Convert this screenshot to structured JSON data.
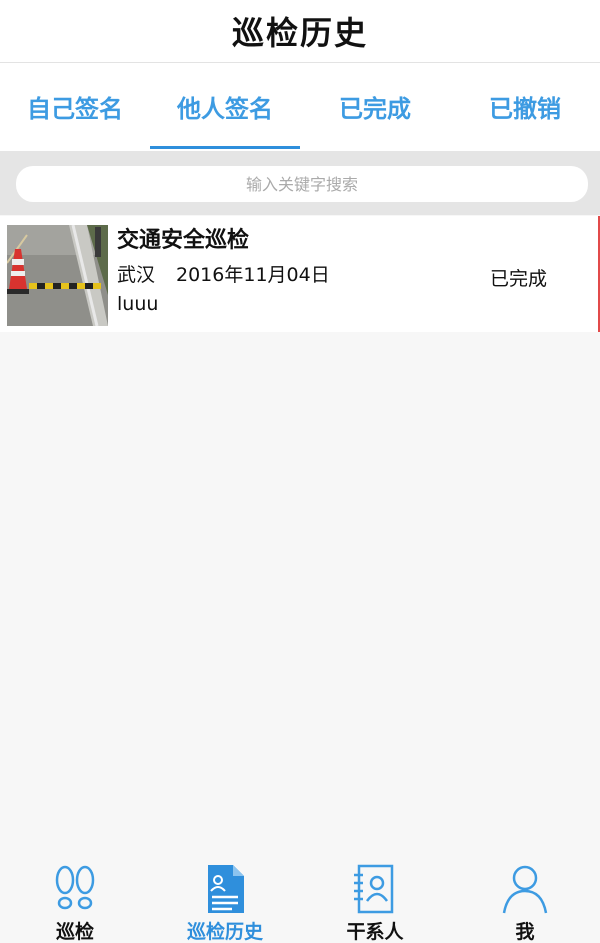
{
  "header": {
    "title": "巡检历史"
  },
  "tabs": [
    {
      "label": "自己签名",
      "active": false
    },
    {
      "label": "他人签名",
      "active": true
    },
    {
      "label": "已完成",
      "active": false
    },
    {
      "label": "已撤销",
      "active": false
    }
  ],
  "search": {
    "placeholder": "输入关键字搜索",
    "value": ""
  },
  "list": [
    {
      "title": "交通安全巡检",
      "location": "武汉",
      "date": "2016年11月04日",
      "user": "luuu",
      "status": "已完成",
      "thumbnail": "road-cone-speed-bump-photo"
    }
  ],
  "bottom_nav": [
    {
      "label": "巡检",
      "icon": "footprints-icon",
      "active": false
    },
    {
      "label": "巡检历史",
      "icon": "document-user-icon",
      "active": true
    },
    {
      "label": "干系人",
      "icon": "contacts-book-icon",
      "active": false
    },
    {
      "label": "我",
      "icon": "person-icon",
      "active": false
    }
  ],
  "colors": {
    "accent": "#2f8fdc",
    "tab_text": "#3d9be2",
    "search_bar_bg": "#e5e5e5",
    "item_edge": "#e24a4a"
  }
}
